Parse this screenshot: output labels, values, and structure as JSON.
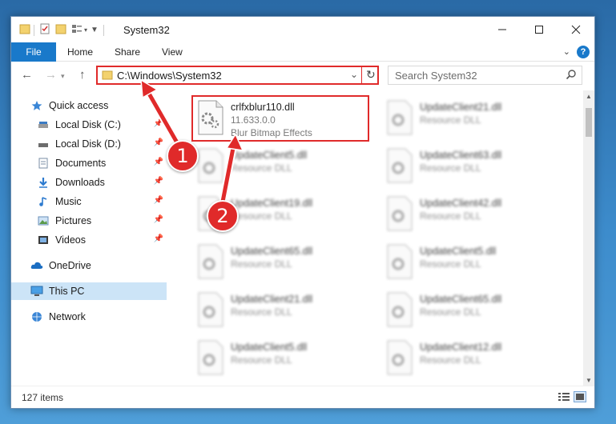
{
  "window": {
    "title": "System32"
  },
  "ribbon": {
    "file": "File",
    "home": "Home",
    "share": "Share",
    "view": "View",
    "help": "?"
  },
  "address": {
    "path": "C:\\Windows\\System32"
  },
  "search": {
    "placeholder": "Search System32"
  },
  "sidebar": {
    "quick_access": "Quick access",
    "items": [
      {
        "label": "Local Disk (C:)",
        "icon": "drive-icon"
      },
      {
        "label": "Local Disk (D:)",
        "icon": "drive-icon"
      },
      {
        "label": "Documents",
        "icon": "documents-icon"
      },
      {
        "label": "Downloads",
        "icon": "downloads-icon"
      },
      {
        "label": "Music",
        "icon": "music-icon"
      },
      {
        "label": "Pictures",
        "icon": "pictures-icon"
      },
      {
        "label": "Videos",
        "icon": "videos-icon"
      }
    ],
    "onedrive": "OneDrive",
    "this_pc": "This PC",
    "network": "Network"
  },
  "files": {
    "selected": {
      "name": "crlfxblur110.dll",
      "version": "11.633.0.0",
      "description": "Blur Bitmap Effects"
    },
    "left": [
      {
        "name": "UpdateClient5.dll",
        "type": "Resource DLL"
      },
      {
        "name": "UpdateClient19.dll",
        "type": "Resource DLL"
      },
      {
        "name": "UpdateClient65.dll",
        "type": "Resource DLL"
      },
      {
        "name": "UpdateClient21.dll",
        "type": "Resource DLL"
      },
      {
        "name": "UpdateClient5.dll",
        "type": "Resource DLL"
      }
    ],
    "right": [
      {
        "name": "UpdateClient21.dll",
        "type": "Resource DLL"
      },
      {
        "name": "UpdateClient63.dll",
        "type": "Resource DLL"
      },
      {
        "name": "UpdateClient42.dll",
        "type": "Resource DLL"
      },
      {
        "name": "UpdateClient5.dll",
        "type": "Resource DLL"
      },
      {
        "name": "UpdateClient65.dll",
        "type": "Resource DLL"
      },
      {
        "name": "UpdateClient12.dll",
        "type": "Resource DLL"
      }
    ]
  },
  "status": {
    "count": "127 items"
  },
  "callouts": {
    "one": "1",
    "two": "2"
  },
  "colors": {
    "accent": "#1979ca",
    "highlight": "#e02a2a",
    "selected_bg": "#cce4f7"
  }
}
